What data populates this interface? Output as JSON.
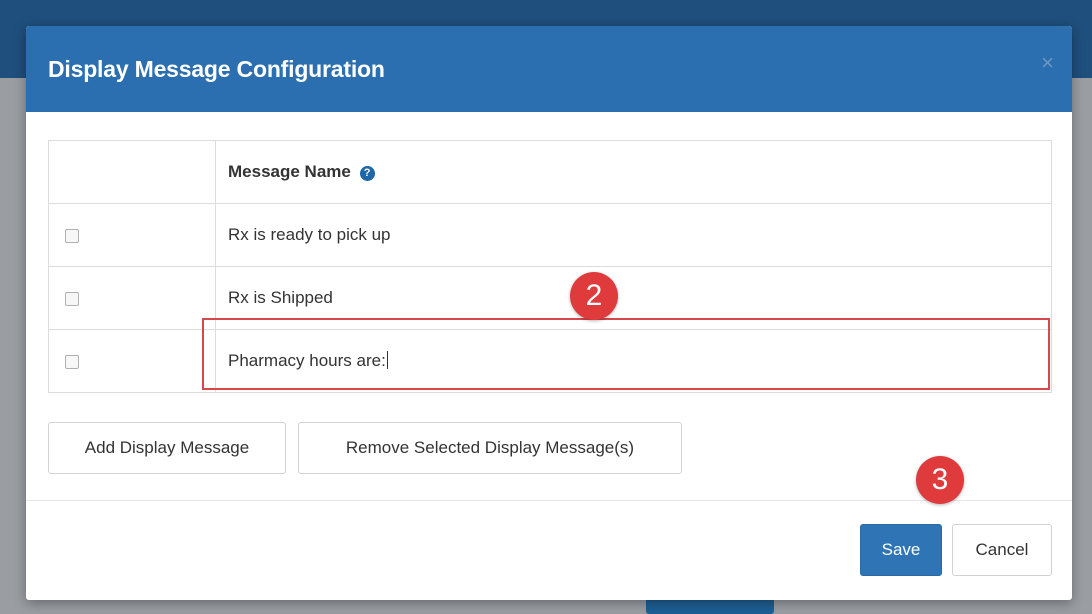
{
  "dialog": {
    "title": "Display Message Configuration",
    "close_glyph": "×"
  },
  "table": {
    "header": "Message Name",
    "help_glyph": "?",
    "rows": [
      {
        "name": "Rx is ready to pick up",
        "checked": false
      },
      {
        "name": "Rx is Shipped",
        "checked": false
      },
      {
        "name": "Pharmacy hours are:",
        "checked": false
      }
    ]
  },
  "actions": {
    "add_label": "Add Display Message",
    "remove_label": "Remove Selected Display Message(s)"
  },
  "footer": {
    "save_label": "Save",
    "cancel_label": "Cancel"
  },
  "annotations": {
    "step_2": "2",
    "step_3": "3",
    "color": "#df3a3c"
  },
  "colors": {
    "header": "#2b6fb0",
    "primary_button": "#2f75b5"
  }
}
